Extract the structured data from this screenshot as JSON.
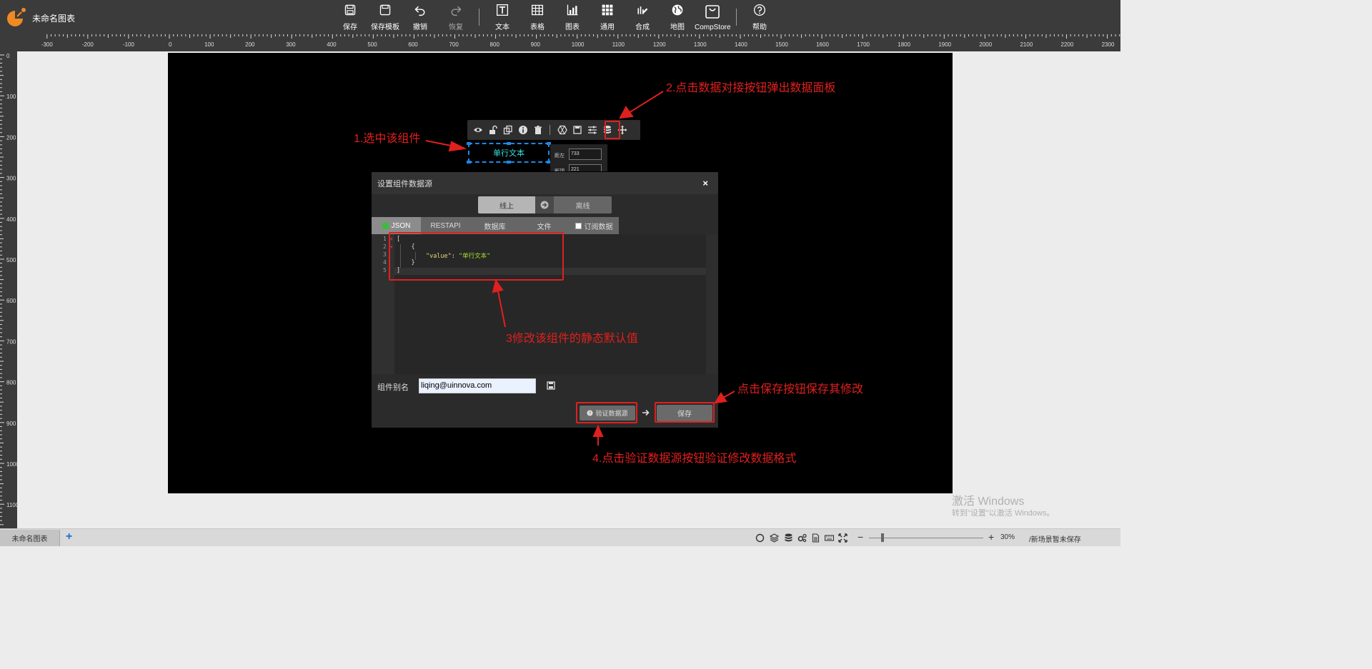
{
  "app": {
    "title": "未命名图表"
  },
  "toolbar": {
    "items": [
      {
        "label": "保存",
        "icon": "save-icon"
      },
      {
        "label": "保存模板",
        "icon": "save-template-icon"
      },
      {
        "label": "撤销",
        "icon": "undo-icon"
      },
      {
        "label": "恢复",
        "icon": "redo-icon"
      },
      {
        "label": "文本",
        "icon": "text-icon"
      },
      {
        "label": "表格",
        "icon": "table-icon"
      },
      {
        "label": "图表",
        "icon": "chart-icon"
      },
      {
        "label": "通用",
        "icon": "grid-icon"
      },
      {
        "label": "合成",
        "icon": "compose-icon"
      },
      {
        "label": "地图",
        "icon": "globe-icon"
      },
      {
        "label": "CompStore",
        "icon": "store-bag-icon"
      },
      {
        "label": "帮助",
        "icon": "help-icon"
      }
    ]
  },
  "ruler": {
    "h_labels": [
      "-300",
      "-200",
      "-100",
      "0",
      "100",
      "200",
      "300",
      "400",
      "500",
      "600",
      "700",
      "800",
      "900",
      "1000",
      "1100",
      "1200",
      "1300",
      "1400",
      "1500",
      "1600",
      "1700",
      "1800",
      "1900",
      "2000",
      "2100",
      "2200",
      "2300"
    ],
    "v_labels": [
      "0",
      "100",
      "200",
      "300",
      "400",
      "500",
      "600",
      "700",
      "800",
      "900",
      "1000",
      "1100"
    ]
  },
  "component": {
    "text": "单行文本",
    "position": {
      "left_label": "距左",
      "left_value": "733",
      "top_label": "距顶",
      "top_value": "221"
    }
  },
  "dialog": {
    "title": "设置组件数据源",
    "close": "×",
    "mode": {
      "online": "线上",
      "offline": "离线"
    },
    "tabs": [
      {
        "label": "JSON",
        "checked": true
      },
      {
        "label": "RESTAPI"
      },
      {
        "label": "数据库"
      },
      {
        "label": "文件"
      },
      {
        "label": "订阅数据",
        "checkbox": true
      }
    ],
    "editor": {
      "line_numbers": [
        "1",
        "2",
        "3",
        "4",
        "5"
      ],
      "lines": [
        "[",
        "    {",
        "        \"value\": \"单行文本\"",
        "    }",
        "]"
      ],
      "key": "\"value\"",
      "value": "\"单行文本\""
    },
    "alias": {
      "label": "组件别名",
      "value": "liqing@uinnova.com"
    },
    "validate_button": "验证数据源",
    "save_button": "保存"
  },
  "annotations": {
    "step1": "1.选中该组件",
    "step2": "2.点击数据对接按钮弹出数据面板",
    "step3": "3修改该组件的静态默认值",
    "step4": "4.点击验证数据源按钮验证修改数据格式",
    "save_note": "点击保存按钮保存其修改",
    "color": "#e0201e"
  },
  "watermark": {
    "line1": "激活 Windows",
    "line2": "转到\"设置\"以激活 Windows。"
  },
  "bottombar": {
    "page_tab": "未命名图表",
    "add": "+",
    "zoom_minus": "−",
    "zoom_plus": "+",
    "zoom": "30%",
    "status": "/新场景暂未保存"
  }
}
